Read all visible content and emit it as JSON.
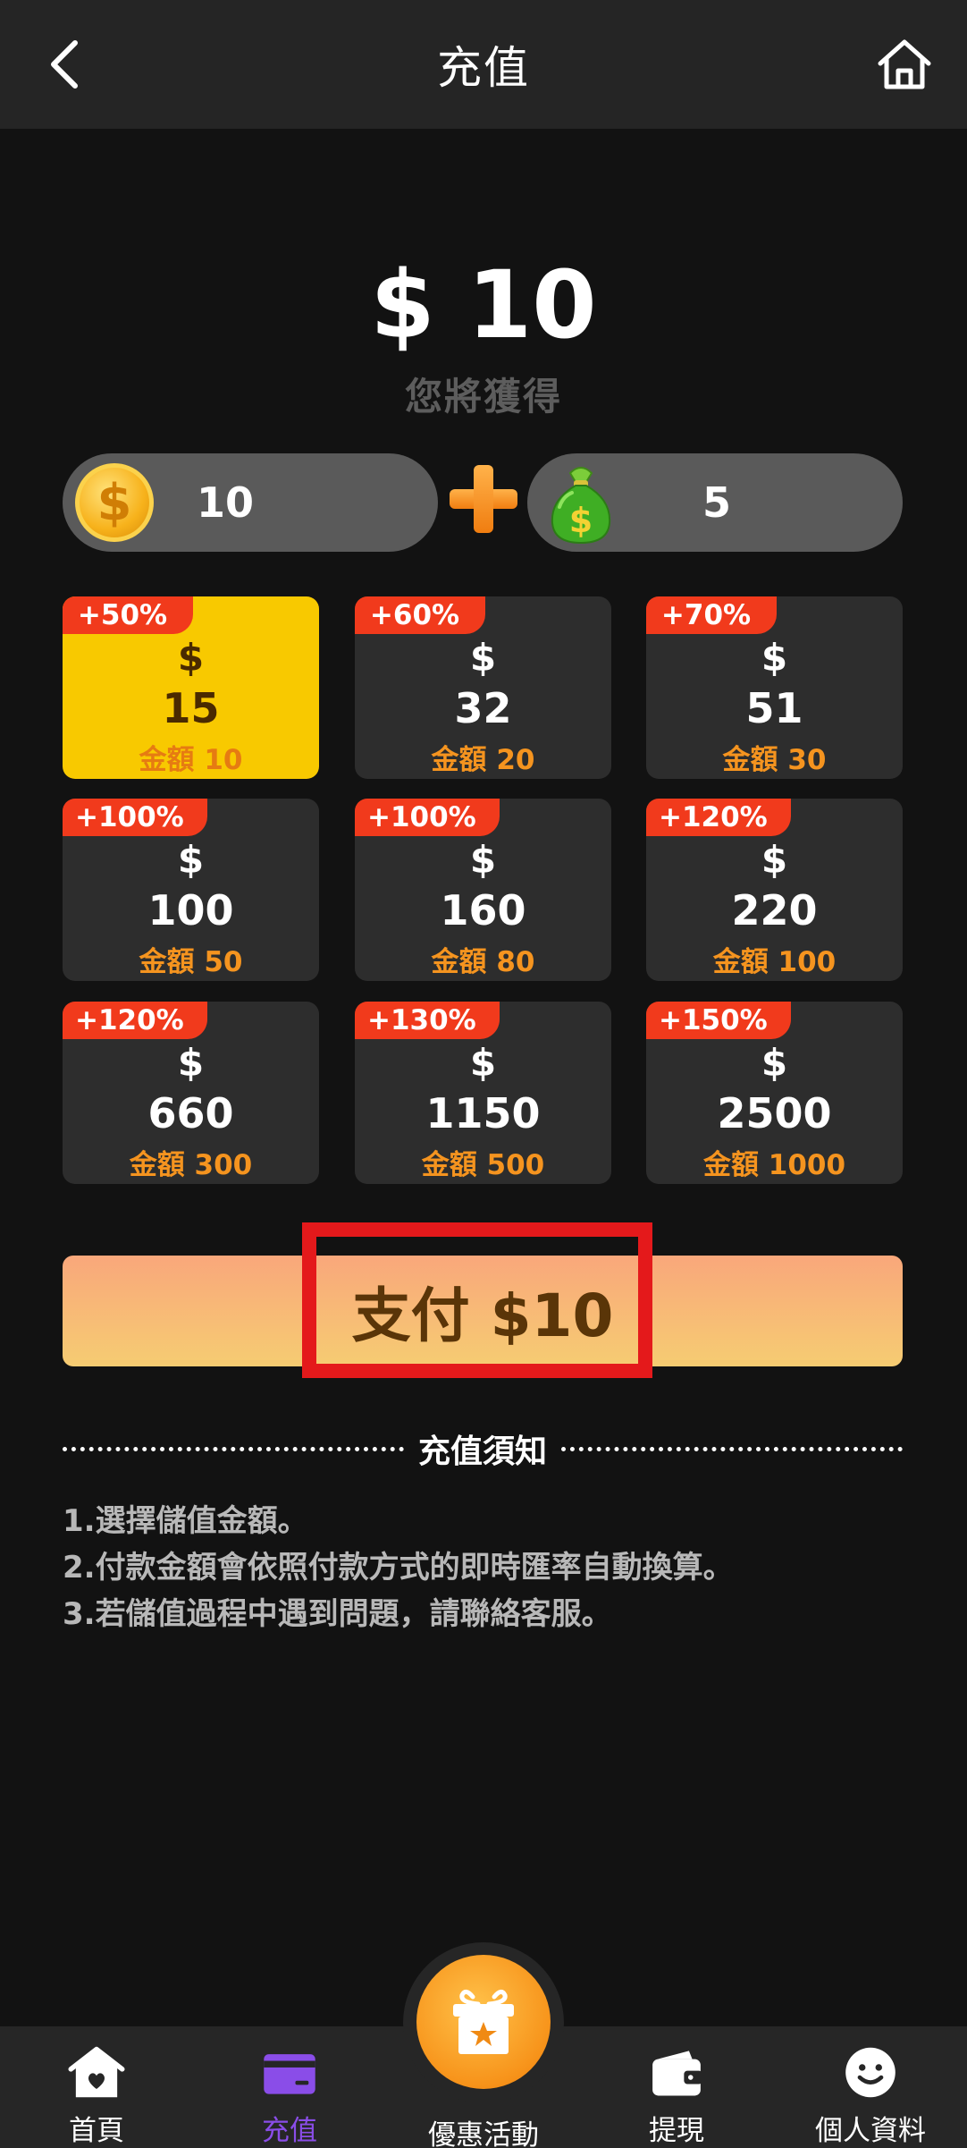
{
  "header": {
    "title": "充值"
  },
  "summary": {
    "amount": "$ 10",
    "will_get_label": "您將獲得"
  },
  "rewards": {
    "coin_value": "10",
    "bonus_value": "5"
  },
  "packages": [
    {
      "badge": "+50%",
      "currency": "$",
      "amount": "15",
      "price": "金額 10",
      "selected": true
    },
    {
      "badge": "+60%",
      "currency": "$",
      "amount": "32",
      "price": "金額 20",
      "selected": false
    },
    {
      "badge": "+70%",
      "currency": "$",
      "amount": "51",
      "price": "金額 30",
      "selected": false
    },
    {
      "badge": "+100%",
      "currency": "$",
      "amount": "100",
      "price": "金額 50",
      "selected": false
    },
    {
      "badge": "+100%",
      "currency": "$",
      "amount": "160",
      "price": "金額 80",
      "selected": false
    },
    {
      "badge": "+120%",
      "currency": "$",
      "amount": "220",
      "price": "金額 100",
      "selected": false
    },
    {
      "badge": "+120%",
      "currency": "$",
      "amount": "660",
      "price": "金額 300",
      "selected": false
    },
    {
      "badge": "+130%",
      "currency": "$",
      "amount": "1150",
      "price": "金額 500",
      "selected": false
    },
    {
      "badge": "+150%",
      "currency": "$",
      "amount": "2500",
      "price": "金額 1000",
      "selected": false
    }
  ],
  "pay_button": {
    "label": "支付 $10"
  },
  "notice": {
    "title": "充值須知",
    "items": [
      "1.選擇儲值金額。",
      "2.付款金額會依照付款方式的即時匯率自動換算。",
      "3.若儲值過程中遇到問題，請聯絡客服。"
    ]
  },
  "nav": {
    "home": "首頁",
    "recharge": "充值",
    "promotions": "優惠活動",
    "withdraw": "提現",
    "profile": "個人資料",
    "active": "recharge"
  },
  "colors": {
    "background": "#121212",
    "header": "#252525",
    "selected_package": "#f8c900",
    "badge": "#f13a1c",
    "price_text": "#f5941f",
    "pay_gradient_top": "#f9a77b",
    "pay_gradient_bottom": "#f6cc72",
    "highlight": "#e4191b",
    "nav_active": "#8a4de8"
  }
}
